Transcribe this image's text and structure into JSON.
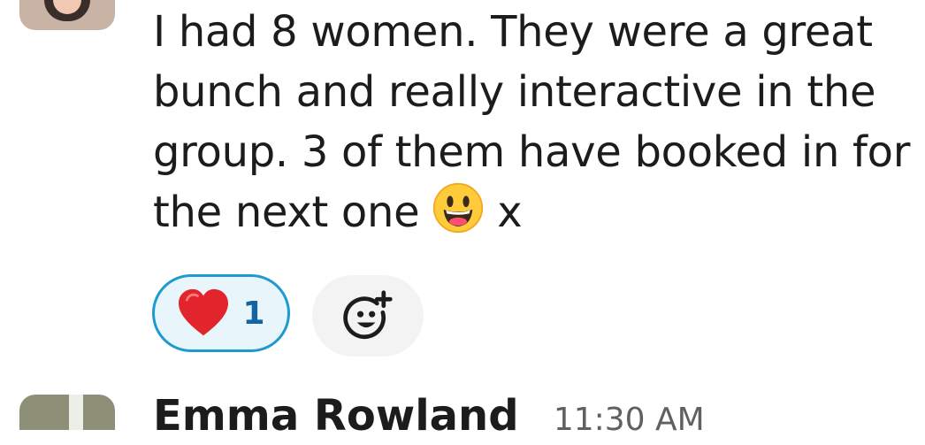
{
  "message": {
    "line1": "I had 8 women. They were a great",
    "line2": "bunch and really interactive in the",
    "line3": "group. 3 of them have booked in for",
    "line4_before_emoji": "the next one",
    "line4_after_emoji": "x",
    "emoji_icon": "grinning-face-emoji-icon"
  },
  "reactions": [
    {
      "icon": "heart-emoji-icon",
      "count": "1",
      "selected": true,
      "border_color": "#1d9bd1",
      "background_color": "#e8f5fa",
      "count_color": "#1264a3"
    }
  ],
  "add_reaction": {
    "icon": "add-reaction-icon"
  },
  "next_message": {
    "author": "Emma Rowland",
    "time": "11:30 AM"
  }
}
